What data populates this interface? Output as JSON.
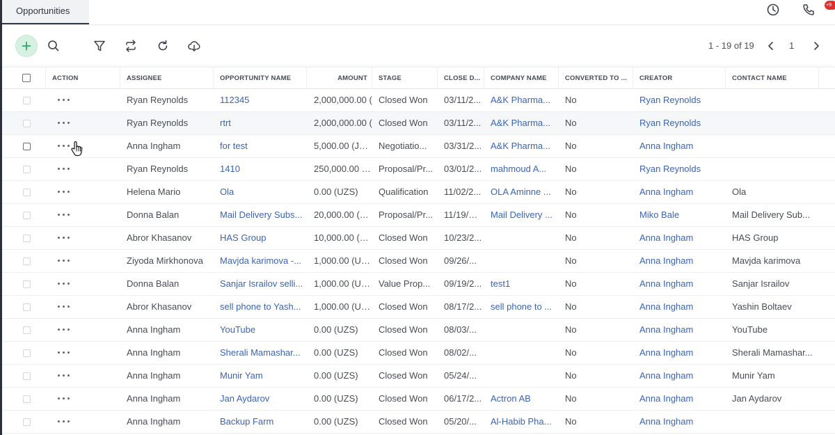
{
  "tab": {
    "label": "Opportunities"
  },
  "header": {
    "phone_badge": "+9"
  },
  "toolbar": {
    "icons": [
      "plus-icon",
      "search-icon",
      "filter-icon",
      "swap-icon",
      "refresh-icon",
      "cloud-download-icon"
    ],
    "add_color": "#2fa86b"
  },
  "pager": {
    "range": "1 - 19 of 19",
    "page": "1"
  },
  "columns": {
    "action": "ACTION",
    "assignee": "ASSIGNEE",
    "opportunity_name": "OPPORTUNITY NAME",
    "amount": "AMOUNT",
    "stage": "STAGE",
    "close_date": "CLOSE D...",
    "company_name": "COMPANY NAME",
    "converted_to": "CONVERTED TO ...",
    "creator": "CREATOR",
    "contact_name": "CONTACT NAME"
  },
  "colors": {
    "link": "#3b64b4",
    "accent_dark": "#2e3a4b",
    "badge": "#e0312e"
  },
  "rows": [
    {
      "assignee": "Ryan Reynolds",
      "opportunity": "112345",
      "amount": "2,000,000.00 (",
      "stage": "Closed Won",
      "close": "03/11/2...",
      "company": "A&K Pharma...",
      "converted": "No",
      "creator": "Ryan Reynolds",
      "contact": ""
    },
    {
      "assignee": "Ryan Reynolds",
      "opportunity": "rtrt",
      "amount": "2,000,000.00 (",
      "stage": "Closed Won",
      "close": "03/11/2...",
      "company": "A&K Pharma...",
      "converted": "No",
      "creator": "Ryan Reynolds",
      "contact": ""
    },
    {
      "assignee": "Anna Ingham",
      "opportunity": "for test",
      "amount": "5,000.00 (JOD",
      "stage": "Negotiatio...",
      "close": "03/31/2...",
      "company": "A&K Pharma...",
      "converted": "No",
      "creator": "Anna Ingham",
      "contact": ""
    },
    {
      "assignee": "Ryan Reynolds",
      "opportunity": "1410",
      "amount": "250,000.00 (UZ",
      "stage": "Proposal/Pr...",
      "close": "03/01/2...",
      "company": "mahmoud A...",
      "converted": "No",
      "creator": "Ryan Reynolds",
      "contact": ""
    },
    {
      "assignee": "Helena Mario",
      "opportunity": "Ola",
      "amount": "0.00 (UZS)",
      "stage": "Qualification",
      "close": "11/02/2...",
      "company": "OLA Aminne ...",
      "converted": "No",
      "creator": "Anna Ingham",
      "contact": "Ola"
    },
    {
      "assignee": "Donna Balan",
      "opportunity": "Mail Delivery Subs...",
      "amount": "20,000.00 (UZS",
      "stage": "Proposal/Pr...",
      "close": "11/19/20...",
      "company": "Mail Delivery ...",
      "converted": "No",
      "creator": "Miko Bale",
      "contact": "Mail Delivery Sub..."
    },
    {
      "assignee": "Abror Khasanov",
      "opportunity": "HAS Group",
      "amount": "10,000.00 (UZS",
      "stage": "Closed Won",
      "close": "10/23/2...",
      "company": "",
      "converted": "No",
      "creator": "Anna Ingham",
      "contact": "HAS Group"
    },
    {
      "assignee": "Ziyoda Mirkhonova",
      "opportunity": "Mavjda karimova -...",
      "amount": "1,000.00 (UZS)",
      "stage": "Closed Won",
      "close": "09/26/...",
      "company": "",
      "converted": "No",
      "creator": "Anna Ingham",
      "contact": "Mavjda karimova"
    },
    {
      "assignee": "Donna Balan",
      "opportunity": "Sanjar Israilov selli...",
      "amount": "1,000.00 (UZS)",
      "stage": "Value Prop...",
      "close": "09/19/2...",
      "company": "test1",
      "converted": "No",
      "creator": "Anna Ingham",
      "contact": "Sanjar Israilov"
    },
    {
      "assignee": "Abror Khasanov",
      "opportunity": "sell phone to Yash...",
      "amount": "1,000.00 (UZS)",
      "stage": "Closed Won",
      "close": "08/17/2...",
      "company": "sell phone to ...",
      "converted": "No",
      "creator": "Anna Ingham",
      "contact": "Yashin Boltaev"
    },
    {
      "assignee": "Anna Ingham",
      "opportunity": "YouTube",
      "amount": "0.00 (UZS)",
      "stage": "Closed Won",
      "close": "08/03/...",
      "company": "",
      "converted": "No",
      "creator": "Anna Ingham",
      "contact": "YouTube"
    },
    {
      "assignee": "Anna Ingham",
      "opportunity": "Sherali Mamashar...",
      "amount": "0.00 (UZS)",
      "stage": "Closed Won",
      "close": "08/02/...",
      "company": "",
      "converted": "No",
      "creator": "Anna Ingham",
      "contact": "Sherali Mamashar..."
    },
    {
      "assignee": "Anna Ingham",
      "opportunity": "Munir Yam",
      "amount": "0.00 (UZS)",
      "stage": "Closed Won",
      "close": "05/24/...",
      "company": "",
      "converted": "No",
      "creator": "Anna Ingham",
      "contact": "Munir Yam"
    },
    {
      "assignee": "Anna Ingham",
      "opportunity": "Jan Aydarov",
      "amount": "0.00 (UZS)",
      "stage": "Closed Won",
      "close": "06/17/2...",
      "company": "Actron AB",
      "converted": "No",
      "creator": "Anna Ingham",
      "contact": "Jan Aydarov"
    },
    {
      "assignee": "Anna Ingham",
      "opportunity": "Backup Farm",
      "amount": "0.00 (UZS)",
      "stage": "Closed Won",
      "close": "05/20/...",
      "company": "Al-Habib Pha...",
      "converted": "No",
      "creator": "Anna Ingham",
      "contact": ""
    }
  ]
}
